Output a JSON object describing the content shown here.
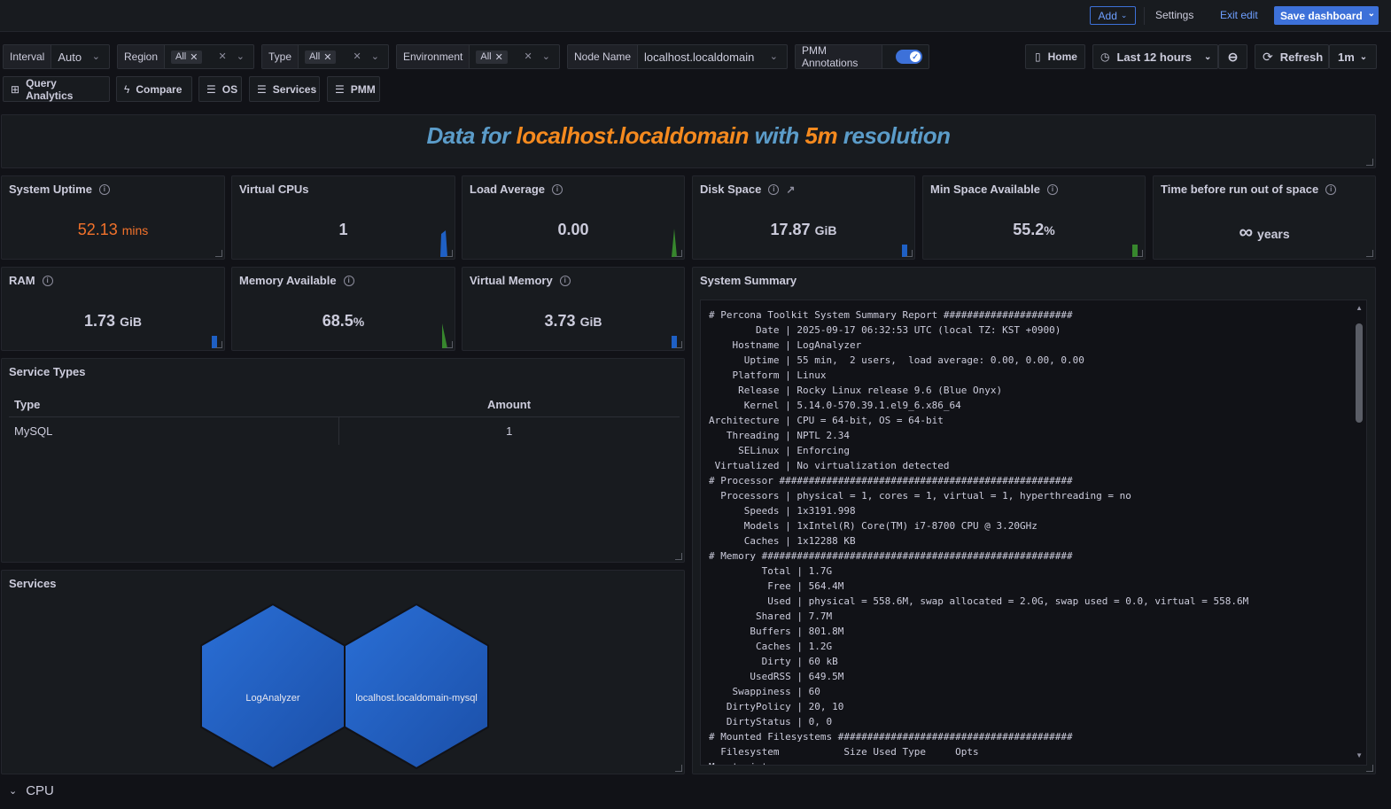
{
  "topbar": {
    "add_label": "Add",
    "settings_label": "Settings",
    "exit_label": "Exit edit",
    "save_label": "Save dashboard"
  },
  "variables": {
    "interval": {
      "label": "Interval",
      "value": "Auto"
    },
    "region": {
      "label": "Region",
      "value": "All"
    },
    "type": {
      "label": "Type",
      "value": "All"
    },
    "environment": {
      "label": "Environment",
      "value": "All"
    },
    "node_name": {
      "label": "Node Name",
      "value": "localhost.localdomain"
    },
    "pmm_annotations": {
      "label": "PMM Annotations",
      "enabled": true
    }
  },
  "time_controls": {
    "home_label": "Home",
    "time_range": "Last 12 hours",
    "refresh_label": "Refresh",
    "refresh_interval": "1m"
  },
  "links": [
    {
      "label": "Query Analytics",
      "icon": "apps-icon"
    },
    {
      "label": "Compare",
      "icon": "bolt-icon"
    },
    {
      "label": "OS",
      "icon": "bars-icon"
    },
    {
      "label": "Services",
      "icon": "bars-icon"
    },
    {
      "label": "PMM",
      "icon": "bars-icon"
    }
  ],
  "banner": {
    "prefix": "Data for ",
    "host": "localhost.localdomain",
    "middle": " with ",
    "resolution": "5m",
    "suffix": " resolution"
  },
  "stats": {
    "uptime": {
      "title": "System Uptime",
      "value": "52.13",
      "unit": "mins"
    },
    "vcpus": {
      "title": "Virtual CPUs",
      "value": "1"
    },
    "load": {
      "title": "Load Average",
      "value": "0.00"
    },
    "disk": {
      "title": "Disk Space",
      "value": "17.87",
      "unit": "GiB"
    },
    "minspace": {
      "title": "Min Space Available",
      "value": "55.2",
      "unit": "%"
    },
    "timeleft": {
      "title": "Time before run out of space",
      "value": "∞",
      "unit": "years"
    },
    "ram": {
      "title": "RAM",
      "value": "1.73",
      "unit": "GiB"
    },
    "memavail": {
      "title": "Memory Available",
      "value": "68.5",
      "unit": "%"
    },
    "vmem": {
      "title": "Virtual Memory",
      "value": "3.73",
      "unit": "GiB"
    }
  },
  "service_types": {
    "title": "Service Types",
    "col_type": "Type",
    "col_amount": "Amount",
    "rows": [
      {
        "type": "MySQL",
        "amount": "1"
      }
    ]
  },
  "services": {
    "title": "Services",
    "items": [
      "LogAnalyzer",
      "localhost.localdomain-mysql"
    ]
  },
  "system_summary": {
    "title": "System Summary",
    "lines": [
      "# Percona Toolkit System Summary Report ######################",
      "        Date | 2025-09-17 06:32:53 UTC (local TZ: KST +0900)",
      "    Hostname | LogAnalyzer",
      "      Uptime | 55 min,  2 users,  load average: 0.00, 0.00, 0.00",
      "    Platform | Linux",
      "     Release | Rocky Linux release 9.6 (Blue Onyx)",
      "      Kernel | 5.14.0-570.39.1.el9_6.x86_64",
      "Architecture | CPU = 64-bit, OS = 64-bit",
      "   Threading | NPTL 2.34",
      "     SELinux | Enforcing",
      " Virtualized | No virtualization detected",
      "# Processor ##################################################",
      "  Processors | physical = 1, cores = 1, virtual = 1, hyperthreading = no",
      "      Speeds | 1x3191.998",
      "      Models | 1xIntel(R) Core(TM) i7-8700 CPU @ 3.20GHz",
      "      Caches | 1x12288 KB",
      "# Memory #####################################################",
      "         Total | 1.7G",
      "          Free | 564.4M",
      "          Used | physical = 558.6M, swap allocated = 2.0G, swap used = 0.0, virtual = 558.6M",
      "        Shared | 7.7M",
      "       Buffers | 801.8M",
      "        Caches | 1.2G",
      "         Dirty | 60 kB",
      "       UsedRSS | 649.5M",
      "    Swappiness | 60",
      "   DirtyPolicy | 20, 10",
      "   DirtyStatus | 0, 0",
      "# Mounted Filesystems ########################################",
      "  Filesystem           Size Used Type     Opts",
      "Mountpoint"
    ]
  },
  "rows": {
    "cpu": "CPU"
  }
}
